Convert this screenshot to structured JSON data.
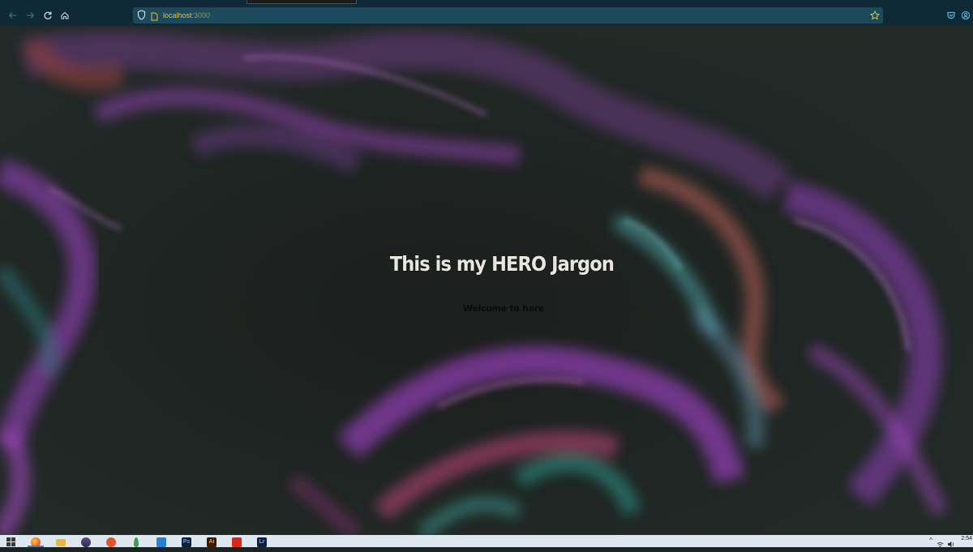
{
  "browser": {
    "url_host": "localhost",
    "url_port": ":3000",
    "nav_icons": [
      "back-arrow-icon",
      "forward-arrow-icon",
      "reload-icon",
      "home-icon"
    ],
    "url_icons": [
      "shield-icon",
      "page-icon",
      "bookmark-star-icon"
    ],
    "toolbar_icons": [
      "pocket-icon",
      "account-icon"
    ]
  },
  "hero": {
    "title": "This is my HERO Jargon",
    "subtitle": "Welcome to here"
  },
  "taskbar": {
    "apps": [
      "windows-start",
      "firefox",
      "file-explorer",
      "app-stack",
      "git-app",
      "mongodb",
      "vscode",
      "photoshop",
      "illustrator",
      "acrobat",
      "lightroom"
    ],
    "app_letters": {
      "photoshop": "Ps",
      "illustrator": "Ai",
      "lightroom": "Lr"
    },
    "clock": "2:54"
  },
  "colors": {
    "chrome_bg": "#0f2a36",
    "urlbar_bg": "#1c4a5c",
    "url_text": "#e8c23a",
    "hero_bg": "#222a27",
    "title": "#e9e6e0",
    "taskbar_bg": "#dde7ee"
  }
}
